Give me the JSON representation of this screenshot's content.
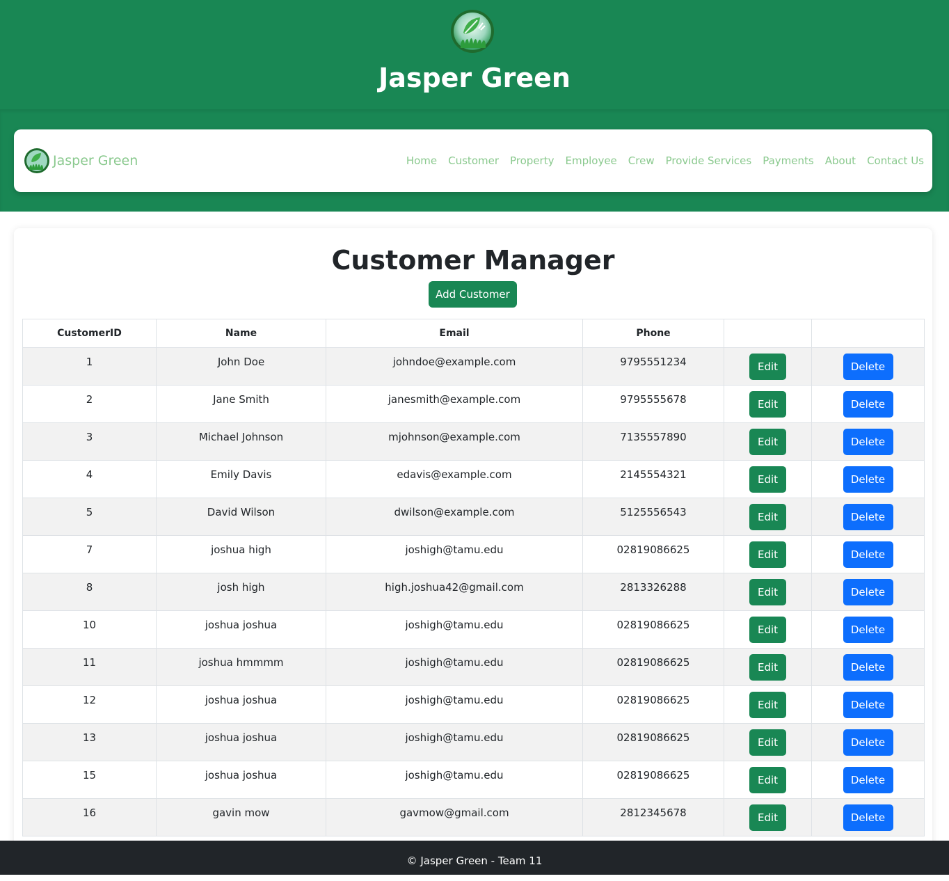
{
  "header": {
    "title": "Jasper Green"
  },
  "navbar": {
    "brand": "Jasper Green",
    "links": [
      "Home",
      "Customer",
      "Property",
      "Employee",
      "Crew",
      "Provide Services",
      "Payments",
      "About",
      "Contact Us"
    ]
  },
  "main": {
    "title": "Customer Manager",
    "add_button": "Add Customer",
    "table": {
      "columns": [
        "CustomerID",
        "Name",
        "Email",
        "Phone",
        "",
        ""
      ],
      "edit_label": "Edit",
      "delete_label": "Delete",
      "rows": [
        {
          "id": "1",
          "name": "John Doe",
          "email": "johndoe@example.com",
          "phone": "9795551234"
        },
        {
          "id": "2",
          "name": "Jane Smith",
          "email": "janesmith@example.com",
          "phone": "9795555678"
        },
        {
          "id": "3",
          "name": "Michael Johnson",
          "email": "mjohnson@example.com",
          "phone": "7135557890"
        },
        {
          "id": "4",
          "name": "Emily Davis",
          "email": "edavis@example.com",
          "phone": "2145554321"
        },
        {
          "id": "5",
          "name": "David Wilson",
          "email": "dwilson@example.com",
          "phone": "5125556543"
        },
        {
          "id": "7",
          "name": "joshua high",
          "email": "joshigh@tamu.edu",
          "phone": "02819086625"
        },
        {
          "id": "8",
          "name": "josh high",
          "email": "high.joshua42@gmail.com",
          "phone": "2813326288"
        },
        {
          "id": "10",
          "name": "joshua joshua",
          "email": "joshigh@tamu.edu",
          "phone": "02819086625"
        },
        {
          "id": "11",
          "name": "joshua hmmmm",
          "email": "joshigh@tamu.edu",
          "phone": "02819086625"
        },
        {
          "id": "12",
          "name": "joshua joshua",
          "email": "joshigh@tamu.edu",
          "phone": "02819086625"
        },
        {
          "id": "13",
          "name": "joshua joshua",
          "email": "joshigh@tamu.edu",
          "phone": "02819086625"
        },
        {
          "id": "15",
          "name": "joshua joshua",
          "email": "joshigh@tamu.edu",
          "phone": "02819086625"
        },
        {
          "id": "16",
          "name": "gavin mow",
          "email": "gavmow@gmail.com",
          "phone": "2812345678"
        }
      ]
    }
  },
  "footer": {
    "text": "© Jasper Green - Team 11"
  },
  "colors": {
    "primary_green": "#198754",
    "nav_link": "#8ac98e",
    "delete_blue": "#0d6efd",
    "footer_dark": "#212529"
  },
  "icons": {
    "header_logo": "leaf-grass-logo-icon",
    "brand_logo": "leaf-grass-logo-icon"
  }
}
